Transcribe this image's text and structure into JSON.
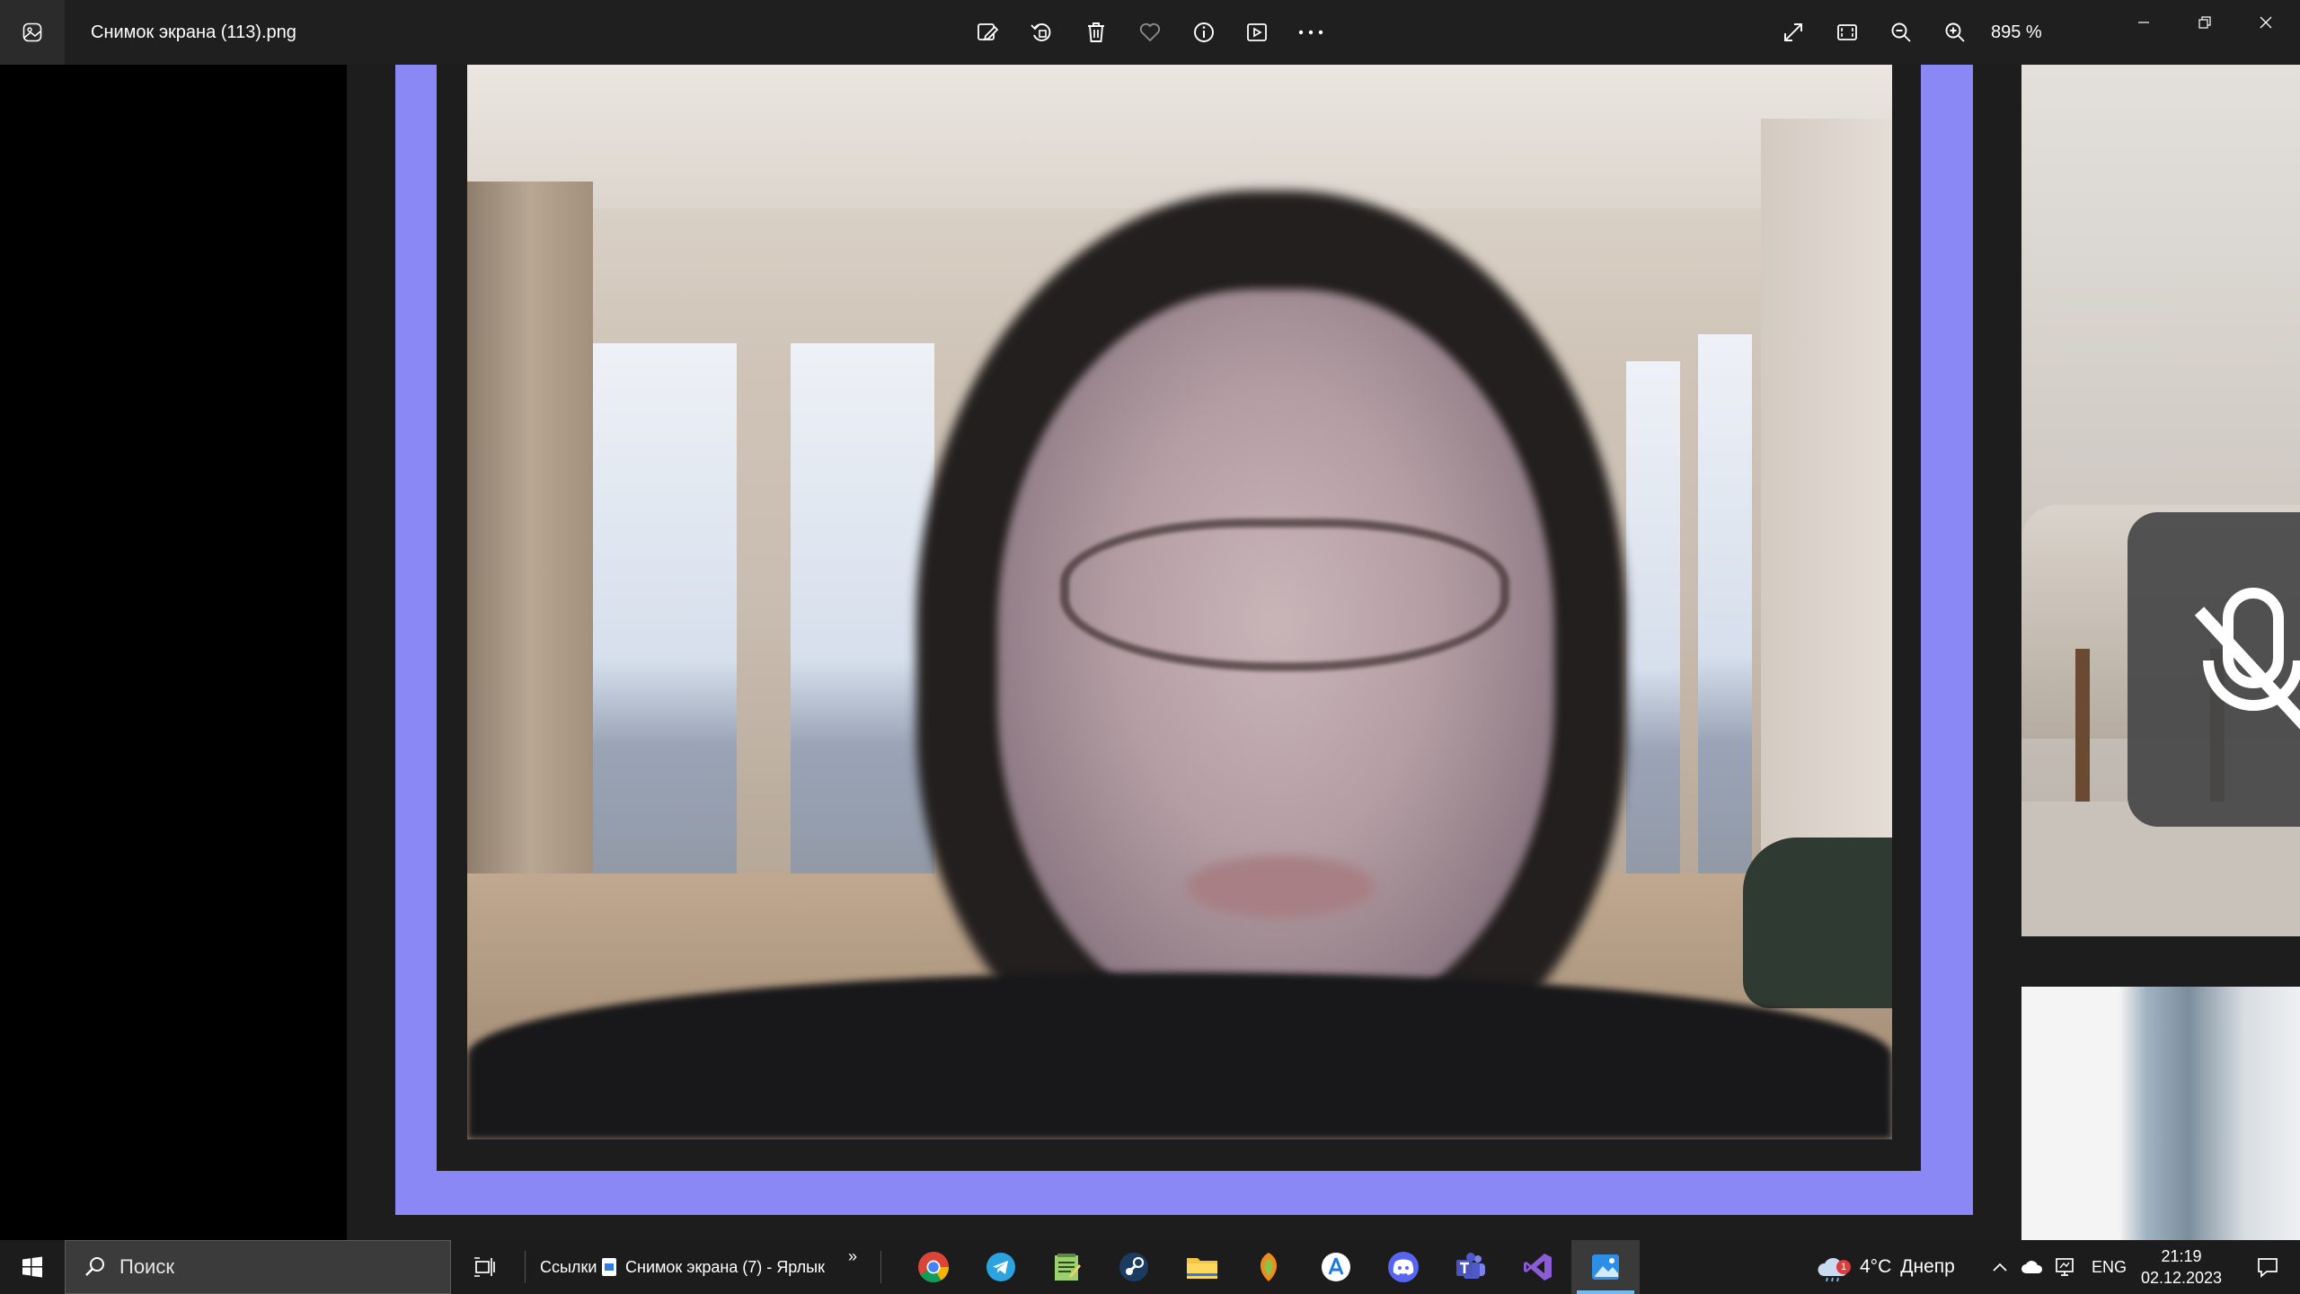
{
  "window": {
    "file_title": "Снимок экрана (113).png",
    "zoom": "895 %"
  },
  "toolbar": {
    "actions": [
      "edit-image",
      "rotate",
      "delete",
      "favorite",
      "info",
      "slideshow",
      "more"
    ],
    "view_actions": [
      "fullscreen",
      "fit-to-window",
      "zoom-out",
      "zoom-in"
    ],
    "window_controls": [
      "minimize",
      "restore",
      "close"
    ]
  },
  "image_content": {
    "frame_border_color": "#8a88f4",
    "muted_indicator": "mic-off-icon"
  },
  "taskbar": {
    "search_placeholder": "Поиск",
    "links_label": "Ссылки",
    "shortcut_label": "Снимок экрана (7) - Ярлык",
    "chevron": "»",
    "pinned_apps": [
      "chrome",
      "telegram",
      "notepad",
      "steam",
      "file-explorer",
      "fl-studio",
      "app-installer",
      "discord",
      "teams",
      "visual-studio",
      "photos"
    ],
    "active_app": "photos",
    "weather": {
      "temperature": "4°C",
      "city": "Днепр",
      "badge": "1"
    },
    "language": "ENG",
    "time": "21:19",
    "date": "02.12.2023"
  }
}
